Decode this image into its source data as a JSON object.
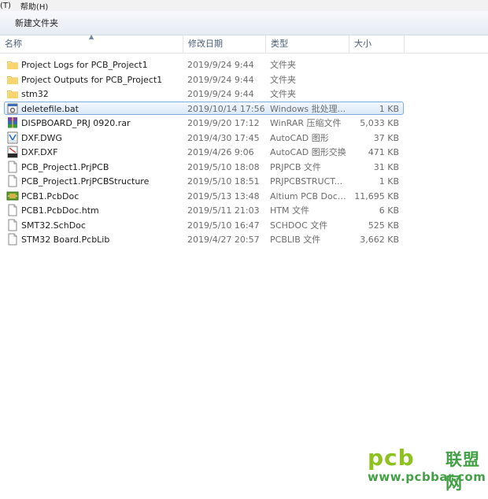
{
  "menubar": {
    "items": [
      "(T)",
      "帮助(H)"
    ]
  },
  "toolbar": {
    "new_folder": "新建文件夹"
  },
  "columns": {
    "name": "名称",
    "date": "修改日期",
    "type": "类型",
    "size": "大小"
  },
  "files": [
    {
      "name": "Project Logs for PCB_Project1",
      "date": "2019/9/24 9:44",
      "type": "文件夹",
      "size": "",
      "icon": "folder-icon"
    },
    {
      "name": "Project Outputs for PCB_Project1",
      "date": "2019/9/24 9:44",
      "type": "文件夹",
      "size": "",
      "icon": "folder-icon"
    },
    {
      "name": "stm32",
      "date": "2019/9/24 9:44",
      "type": "文件夹",
      "size": "",
      "icon": "folder-icon"
    },
    {
      "name": "deletefile.bat",
      "date": "2019/10/14 17:56",
      "type": "Windows 批处理...",
      "size": "1 KB",
      "icon": "batch-file-icon",
      "selected": true
    },
    {
      "name": "DISPBOARD_PRJ  0920.rar",
      "date": "2019/9/20 17:12",
      "type": "WinRAR 压缩文件",
      "size": "5,033 KB",
      "icon": "rar-archive-icon"
    },
    {
      "name": "DXF.DWG",
      "date": "2019/4/30 17:45",
      "type": "AutoCAD 图形",
      "size": "37 KB",
      "icon": "dwg-file-icon"
    },
    {
      "name": "DXF.DXF",
      "date": "2019/4/26 9:06",
      "type": "AutoCAD 图形交换",
      "size": "471 KB",
      "icon": "dxf-file-icon"
    },
    {
      "name": "PCB_Project1.PrjPCB",
      "date": "2019/5/10 18:08",
      "type": "PRJPCB 文件",
      "size": "31 KB",
      "icon": "document-icon"
    },
    {
      "name": "PCB_Project1.PrjPCBStructure",
      "date": "2019/5/10 18:51",
      "type": "PRJPCBSTRUCT...",
      "size": "1 KB",
      "icon": "document-icon"
    },
    {
      "name": "PCB1.PcbDoc",
      "date": "2019/5/13 13:48",
      "type": "Altium PCB Docu...",
      "size": "11,695 KB",
      "icon": "pcb-doc-icon"
    },
    {
      "name": "PCB1.PcbDoc.htm",
      "date": "2019/5/11 21:03",
      "type": "HTM 文件",
      "size": "6 KB",
      "icon": "document-icon"
    },
    {
      "name": "SMT32.SchDoc",
      "date": "2019/5/10 16:47",
      "type": "SCHDOC 文件",
      "size": "525 KB",
      "icon": "document-icon"
    },
    {
      "name": "STM32 Board.PcbLib",
      "date": "2019/4/27 20:57",
      "type": "PCBLIB 文件",
      "size": "3,662 KB",
      "icon": "document-icon"
    }
  ],
  "watermark": {
    "brand": "pcb",
    "cn": "联盟网",
    "url": "www.pcbbar.com"
  },
  "colors": {
    "folder": "#f2c94c",
    "selection_border": "#84acdd",
    "watermark_green": "#8dc21f",
    "watermark_dark_green": "#43a047"
  }
}
